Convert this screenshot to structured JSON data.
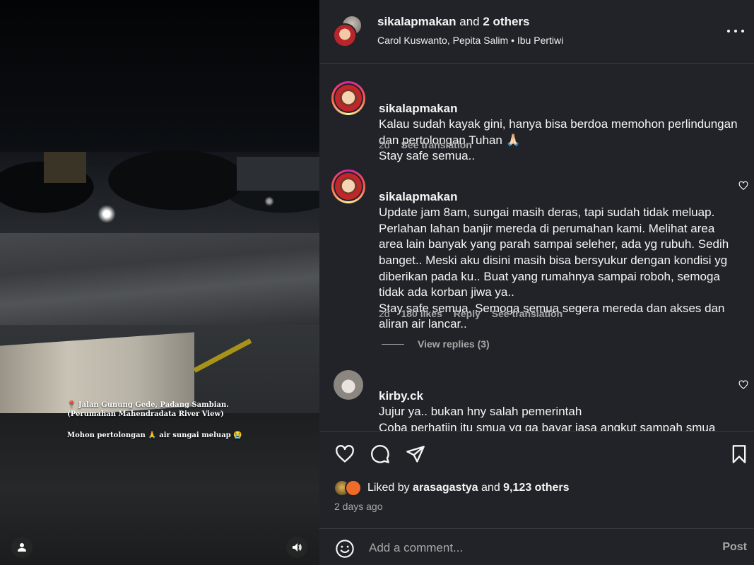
{
  "video": {
    "caption_location": "📍 Jalan Gunung Gede, Padang Sambian. (Perumahan Mahendradata River View)",
    "caption_message": "Mohon pertolongan 🙏 air sungai meluap 😭",
    "tag_icon": "user-icon",
    "sound_icon": "speaker-icon"
  },
  "header": {
    "author": "sikalapmakan",
    "and_text": "and",
    "others": "2 others",
    "subtitle": "Carol Kuswanto, Pepita Salim • Ibu Pertiwi"
  },
  "comments": [
    {
      "user": "sikalapmakan",
      "text": "Kalau sudah kayak gini, hanya bisa berdoa memohon perlindungan dan pertolongan Tuhan 🙏🏻\nStay safe semua..",
      "time": "2d",
      "see_translation": "See translation"
    },
    {
      "user": "sikalapmakan",
      "text": "Update jam 8am, sungai masih deras, tapi sudah tidak meluap. Perlahan lahan banjir mereda di perumahan kami. Melihat area area lain banyak yang parah sampai seleher, ada yg rubuh. Sedih banget.. Meski aku disini masih bisa bersyukur dengan kondisi yg diberikan pada ku.. Buat yang rumahnya sampai roboh, semoga tidak ada korban jiwa ya..\nStay safe semua. Semoga semua segera mereda dan akses dan aliran air lancar..",
      "time": "2d",
      "likes": "180 likes",
      "reply": "Reply",
      "see_translation": "See translation",
      "view_replies": "View replies (3)"
    },
    {
      "user": "kirby.ck",
      "text": "Jujur ya.. bukan hny salah pemerintah\nCoba perhatiin itu smua yg ga bayar jasa angkut sampah smua sampah dibuang ke sungai TANPA memikirkan dampaknya pas musim hujan gini 😳 😳"
    }
  ],
  "liked_by": {
    "prefix": "Liked by",
    "user": "arasagastya",
    "and_text": "and",
    "others": "9,123 others"
  },
  "date": "2 days ago",
  "add_comment": {
    "placeholder": "Add a comment...",
    "post": "Post"
  }
}
